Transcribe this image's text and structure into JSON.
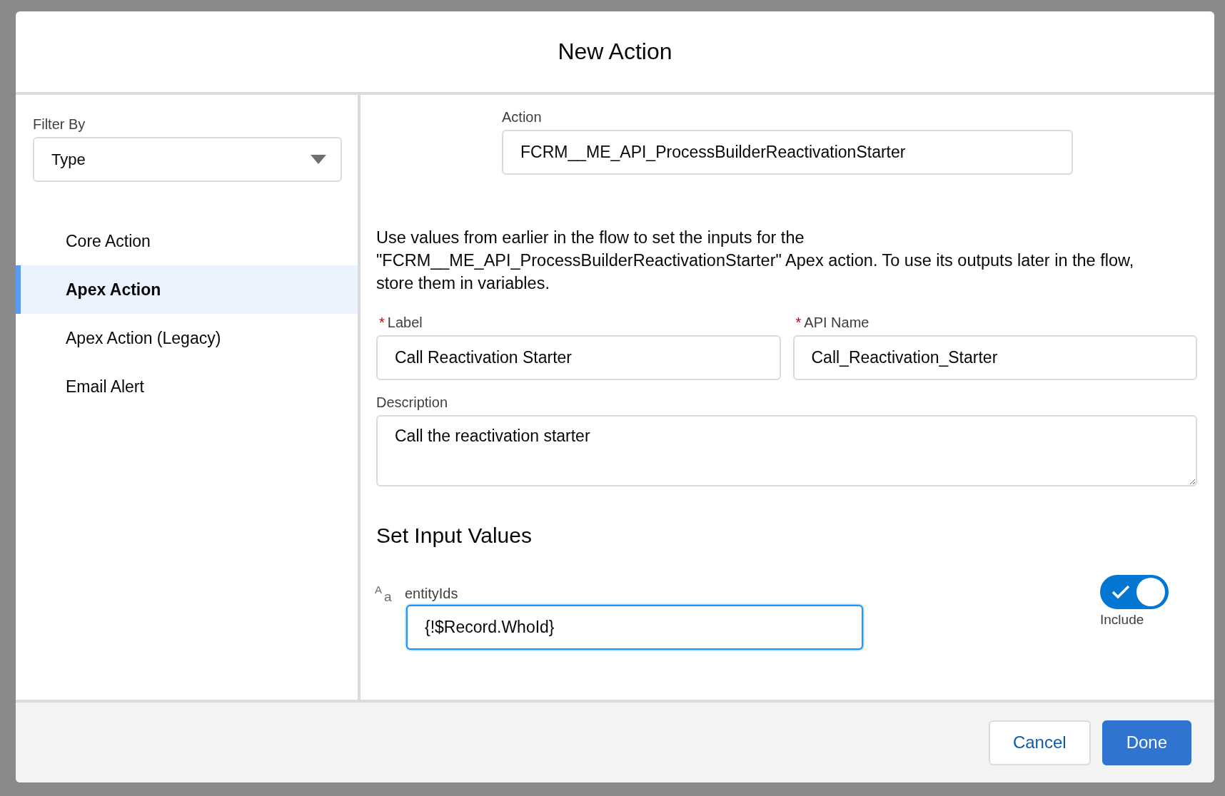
{
  "dialog": {
    "title": "New Action"
  },
  "sidebar": {
    "filter_label": "Filter By",
    "filter_value": "Type",
    "items": [
      {
        "label": "Core Action",
        "selected": false
      },
      {
        "label": "Apex Action",
        "selected": true
      },
      {
        "label": "Apex Action (Legacy)",
        "selected": false
      },
      {
        "label": "Email Alert",
        "selected": false
      }
    ]
  },
  "action": {
    "label": "Action",
    "value": "FCRM__ME_API_ProcessBuilderReactivationStarter"
  },
  "intro_text": "Use values from earlier in the flow to set the inputs for the \"FCRM__ME_API_ProcessBuilderReactivationStarter\" Apex action. To use its outputs later in the flow, store them in variables.",
  "fields": [
    {
      "label": "Label",
      "required_mark": "*",
      "value": "Call Reactivation Starter"
    },
    {
      "label": "API Name",
      "required_mark": "*",
      "value": "Call_Reactivation_Starter"
    }
  ],
  "description": {
    "label": "Description",
    "value": "Call the reactivation starter"
  },
  "input_section": {
    "title": "Set Input Values",
    "inputs": [
      {
        "type_icon": {
          "upper": "A",
          "lower": "a"
        },
        "name": "entityIds",
        "value": "{!$Record.WhoId}",
        "focused": true,
        "include": {
          "label": "Include",
          "on": true
        }
      }
    ]
  },
  "buttons": [
    {
      "label": "Cancel",
      "kind": "neutral"
    },
    {
      "label": "Done",
      "kind": "brand"
    }
  ]
}
